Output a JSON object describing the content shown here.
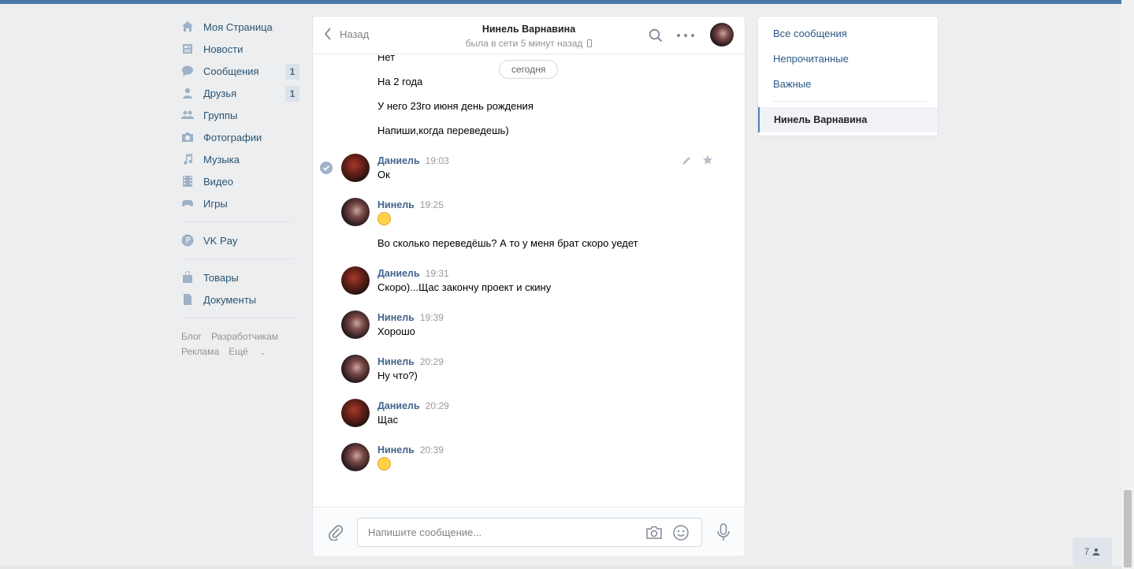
{
  "sidebar": {
    "items": [
      {
        "label": "Моя Страница",
        "icon": "home-icon"
      },
      {
        "label": "Новости",
        "icon": "news-icon"
      },
      {
        "label": "Сообщения",
        "icon": "messages-icon",
        "count": "1"
      },
      {
        "label": "Друзья",
        "icon": "friends-icon",
        "count": "1"
      },
      {
        "label": "Группы",
        "icon": "groups-icon"
      },
      {
        "label": "Фотографии",
        "icon": "camera-icon"
      },
      {
        "label": "Музыка",
        "icon": "music-icon"
      },
      {
        "label": "Видео",
        "icon": "video-icon"
      },
      {
        "label": "Игры",
        "icon": "gamepad-icon"
      }
    ],
    "vkpay": "VK Pay",
    "goods": "Товары",
    "docs": "Документы",
    "footer": {
      "blog": "Блог",
      "dev": "Разработчикам",
      "ads": "Реклама",
      "more": "Ещё"
    }
  },
  "chat": {
    "back_label": "Назад",
    "peer_name": "Нинель Варнавина",
    "peer_status": "была в сети 5 минут назад",
    "date_pill": "сегодня",
    "prev_lines": [
      "Нет",
      "На 2 года",
      "У него 23го июня день рождения",
      "Напиши,когда переведешь)"
    ],
    "messages": [
      {
        "name": "Даниель",
        "time": "19:03",
        "text": "Ок"
      },
      {
        "name": "Нинель",
        "time": "19:25",
        "text": "Во сколько переведёшь? А то у меня брат скоро уедет"
      },
      {
        "name": "Даниель",
        "time": "19:31",
        "text": "Скоро)...Щас закончу проект и скину"
      },
      {
        "name": "Нинель",
        "time": "19:39",
        "text": "Хорошо"
      },
      {
        "name": "Нинель",
        "time": "20:29",
        "text": "Ну что?)"
      },
      {
        "name": "Даниель",
        "time": "20:29",
        "text": "Щас"
      },
      {
        "name": "Нинель",
        "time": "20:39",
        "text": ""
      }
    ],
    "input_placeholder": "Напишите сообщение..."
  },
  "right_menu": {
    "all": "Все сообщения",
    "unread": "Непрочитанные",
    "important": "Важные",
    "selected": "Нинель Варнавина"
  },
  "online_count": "7",
  "colors": {
    "accent": "#4a76a8",
    "link": "#2a5885",
    "name": "#42648b"
  }
}
